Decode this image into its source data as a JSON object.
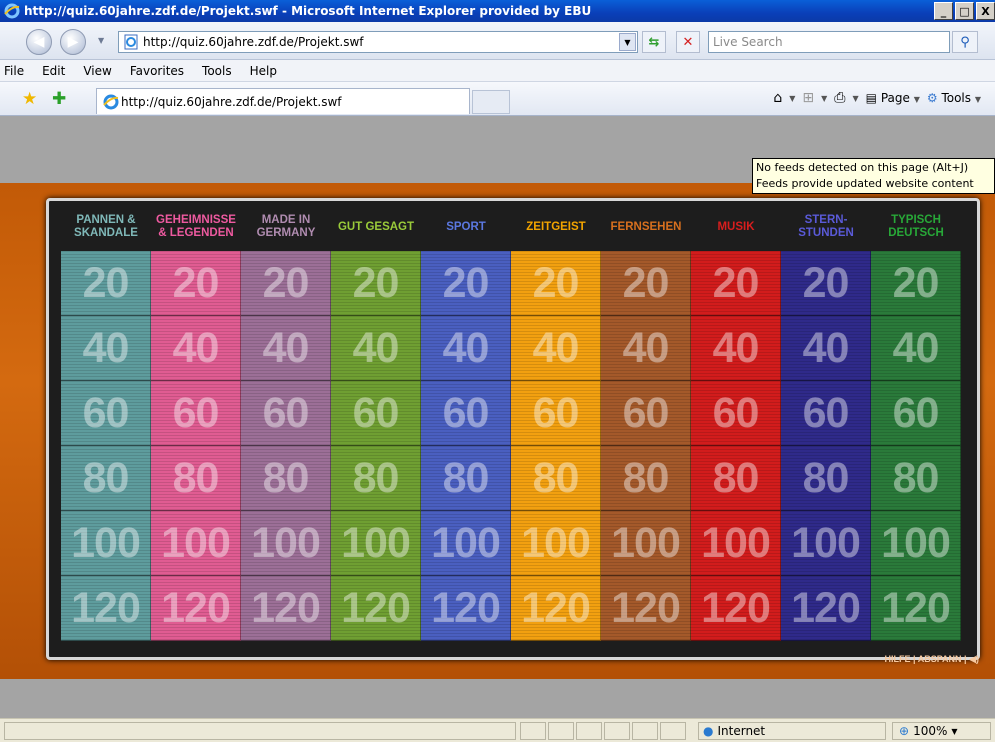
{
  "window": {
    "title": "http://quiz.60jahre.zdf.de/Projekt.swf - Microsoft Internet Explorer provided by EBU",
    "buttons": [
      "_",
      "□",
      "X"
    ]
  },
  "navbar": {
    "back_symbol": "◀",
    "forward_symbol": "▶",
    "address_value": "http://quiz.60jahre.zdf.de/Projekt.swf",
    "search_placeholder": "Live Search"
  },
  "menu": [
    "File",
    "Edit",
    "View",
    "Favorites",
    "Tools",
    "Help"
  ],
  "favbar": {
    "tab_label": "http://quiz.60jahre.zdf.de/Projekt.swf",
    "page_label": "Page",
    "tools_label": "Tools"
  },
  "tooltip": {
    "line1": "No feeds detected on this page (Alt+J)",
    "line2": "Feeds provide updated website content"
  },
  "board": {
    "categories": [
      {
        "label": "PANNEN &\nSKANDALE",
        "color": "#7fb8b8"
      },
      {
        "label": "GEHEIMNISSE\n& LEGENDEN",
        "color": "#ee5aa0"
      },
      {
        "label": "MADE IN\nGERMANY",
        "color": "#b08cb0"
      },
      {
        "label": "GUT GESAGT",
        "color": "#9acb3a"
      },
      {
        "label": "SPORT",
        "color": "#5b78e0"
      },
      {
        "label": "ZEITGEIST",
        "color": "#f2a400"
      },
      {
        "label": "FERNSEHEN",
        "color": "#d8701e"
      },
      {
        "label": "MUSIK",
        "color": "#d81e1e"
      },
      {
        "label": "STERN-\nSTUNDEN",
        "color": "#5a5ad8"
      },
      {
        "label": "TYPISCH\nDEUTSCH",
        "color": "#28a838"
      }
    ],
    "column_colors": [
      "#5e9c9d",
      "#e05c92",
      "#9c6f97",
      "#6f9f32",
      "#4a5fc0",
      "#f2a010",
      "#a4592a",
      "#d21c1c",
      "#2f2a8a",
      "#2a7a3a"
    ],
    "values": [
      "20",
      "40",
      "60",
      "80",
      "100",
      "120"
    ],
    "footer": "HILFE  |  ABSPANN  |  ◀)"
  },
  "statusbar": {
    "zone": "Internet",
    "zoom": "100%"
  }
}
